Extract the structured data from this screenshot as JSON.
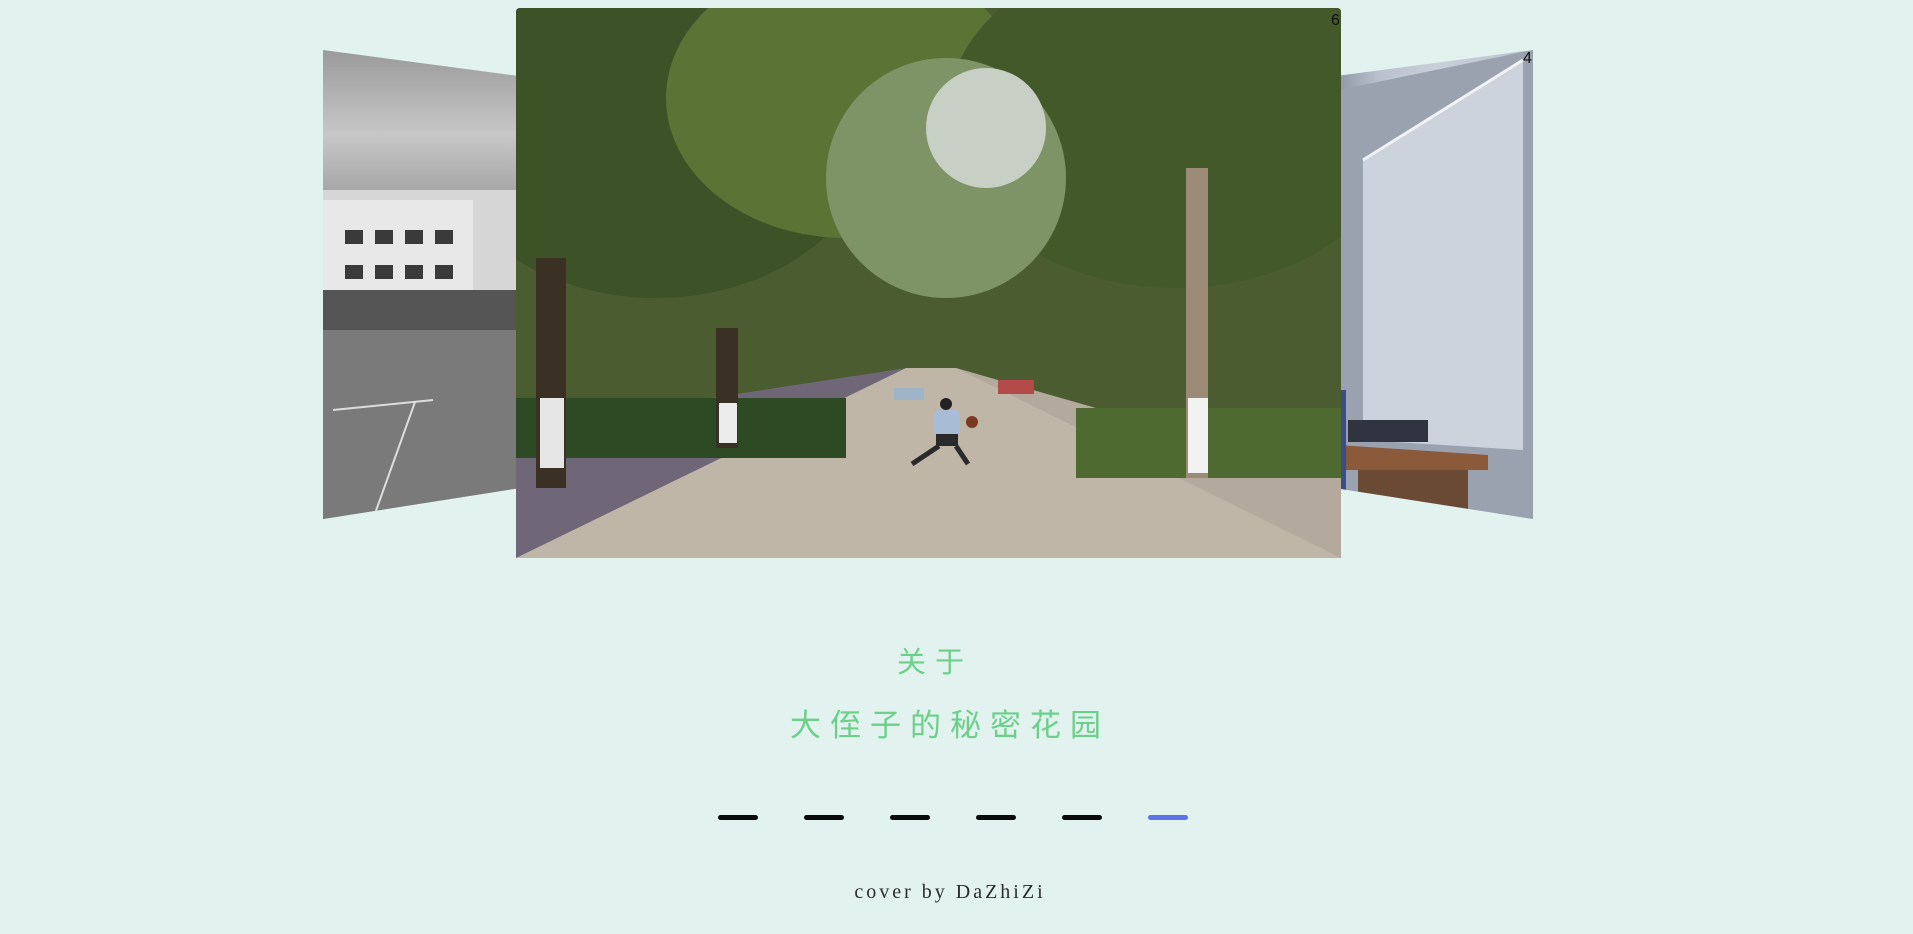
{
  "carousel": {
    "left_slide_alt": "black and white photo of a school building and basketball court",
    "center_slide_alt": "a person dribbling a basketball on a tree-lined street",
    "right_slide_alt": "corner of a room with a white board and a keyboard on a desk",
    "center_index": "6",
    "right_index": "4",
    "dots": [
      {
        "active": false
      },
      {
        "active": false
      },
      {
        "active": false
      },
      {
        "active": false
      },
      {
        "active": false
      },
      {
        "active": true
      }
    ],
    "active_color": "#5b72e8",
    "inactive_color": "#0a0a0a"
  },
  "about": {
    "label": "关于",
    "title": "大侄子的秘密花园"
  },
  "footer": {
    "credit": "cover by DaZhiZi"
  },
  "colors": {
    "background": "#e1f2ef",
    "accent_text": "#6ccf8a"
  }
}
